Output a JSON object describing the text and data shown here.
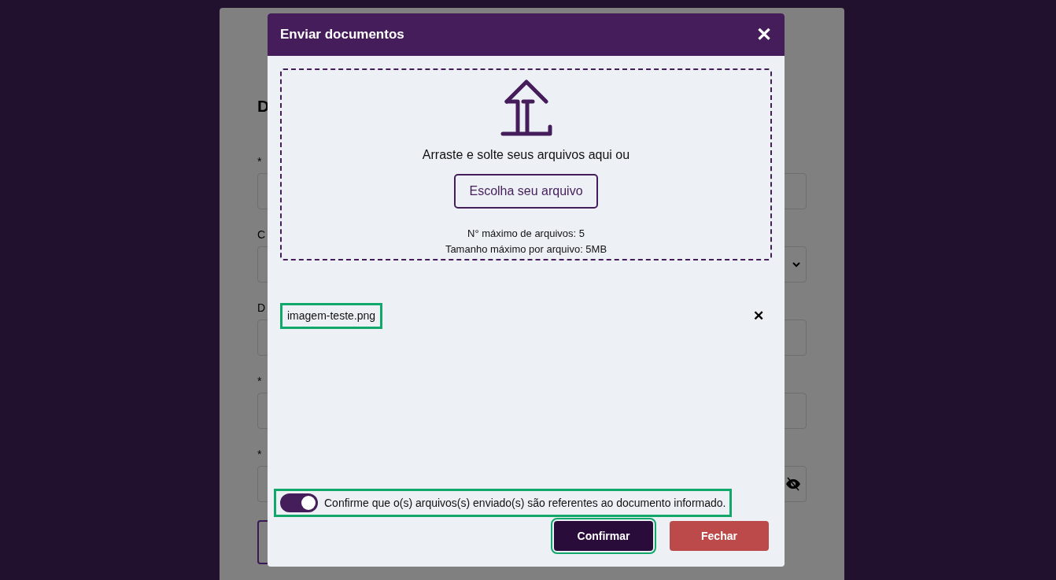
{
  "background_form": {
    "heading": "D",
    "fields": [
      {
        "label": "*",
        "kind": "text"
      },
      {
        "label": "C",
        "kind": "select"
      },
      {
        "label": "D",
        "kind": "text"
      },
      {
        "label": "*",
        "kind": "text"
      },
      {
        "label": "*",
        "kind": "password"
      }
    ]
  },
  "dialog": {
    "title": "Enviar documentos",
    "close": "✕",
    "dropzone": {
      "prompt": "Arraste e solte seus arquivos aqui ou",
      "button": "Escolha seu arquivo",
      "limits": [
        "N° máximo de arquivos: 5",
        "Tamanho máximo por arquivo: 5MB"
      ]
    },
    "files": [
      {
        "name": "imagem-teste.png",
        "remove": "✕",
        "focused": true
      }
    ],
    "confirmation": {
      "label": "Confirme que o(s) arquivos(s) enviado(s) são referentes ao documento informado.",
      "on": true,
      "focused": true
    },
    "buttons": [
      {
        "label": "Confirmar",
        "kind": "primary",
        "focused": true
      },
      {
        "label": "Fechar",
        "kind": "danger",
        "focused": false
      }
    ]
  }
}
